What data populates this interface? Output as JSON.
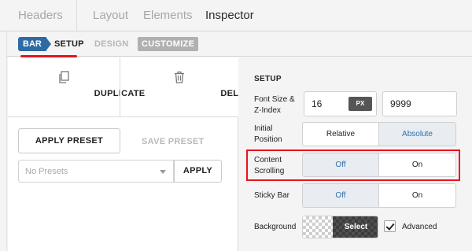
{
  "top_tabs": [
    {
      "label": "Headers",
      "active": false
    },
    {
      "label": "Layout",
      "active": false
    },
    {
      "label": "Elements",
      "active": false
    },
    {
      "label": "Inspector",
      "active": true
    }
  ],
  "breadcrumb": {
    "bar": "BAR",
    "setup": "SETUP",
    "design": "DESIGN",
    "customize": "CUSTOMIZE"
  },
  "actions": {
    "duplicate": "DUPLICATE",
    "delete": "DELETE"
  },
  "presets": {
    "apply_preset": "APPLY PRESET",
    "save_preset": "SAVE PRESET",
    "select_value": "No Presets",
    "apply": "APPLY"
  },
  "setup": {
    "title": "SETUP",
    "font_size_label_line1": "Font Size &",
    "font_size_label_line2": "Z-Index",
    "font_size_value": "16",
    "font_size_unit": "PX",
    "z_index_value": "9999",
    "initial_position_label_line1": "Initial",
    "initial_position_label_line2": "Position",
    "position_options": [
      "Relative",
      "Absolute"
    ],
    "position_selected": "Absolute",
    "content_scrolling_label_line1": "Content",
    "content_scrolling_label_line2": "Scrolling",
    "content_scrolling_options": [
      "Off",
      "On"
    ],
    "content_scrolling_selected": "Off",
    "sticky_bar_label": "Sticky Bar",
    "sticky_bar_options": [
      "Off",
      "On"
    ],
    "sticky_bar_selected": "Off",
    "background_label": "Background",
    "background_select": "Select",
    "advanced_label": "Advanced",
    "advanced_checked": true
  },
  "colors": {
    "accent_blue": "#2e6aa5",
    "highlight_red": "#e8141e"
  }
}
